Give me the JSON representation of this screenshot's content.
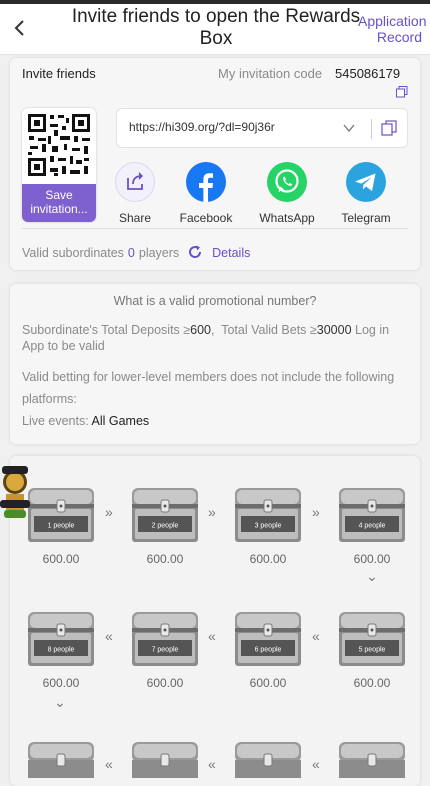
{
  "header": {
    "title": "Invite friends to open the Rewards Box",
    "right_link": "Application Record"
  },
  "invite": {
    "label": "Invite friends",
    "code_label": "My invitation code",
    "code": "545086179",
    "save_label": "Save invitation...",
    "link": "https://hi309.org/?dl=90j36r"
  },
  "share": [
    {
      "label": "Share",
      "icon": "share-arrow-icon",
      "color": "#f2f0fb"
    },
    {
      "label": "Facebook",
      "icon": "facebook-icon",
      "color": "#1877f2"
    },
    {
      "label": "WhatsApp",
      "icon": "whatsapp-icon",
      "color": "#25d366"
    },
    {
      "label": "Telegram",
      "icon": "telegram-icon",
      "color": "#2aa3df"
    }
  ],
  "valid": {
    "label": "Valid subordinates",
    "count": "0",
    "unit": "players",
    "details": "Details"
  },
  "rules": {
    "title": "What is a valid promotional number?",
    "deposits_label": "Subordinate's Total Deposits ≥",
    "deposits_value": "600",
    "bets_label": "Total Valid Bets ≥",
    "bets_value": "30000",
    "suffix": "Log in App to be valid",
    "exclusion": "Valid betting for lower-level members does not include the following platforms:",
    "live_label": "Live events:",
    "live_value": "All Games"
  },
  "chests": [
    {
      "people": "1 people",
      "amount": "600.00"
    },
    {
      "people": "2 people",
      "amount": "600.00"
    },
    {
      "people": "3 people",
      "amount": "600.00"
    },
    {
      "people": "4 people",
      "amount": "600.00"
    },
    {
      "people": "5 people",
      "amount": "600.00"
    },
    {
      "people": "6 people",
      "amount": "600.00"
    },
    {
      "people": "7 people",
      "amount": "600.00"
    },
    {
      "people": "8 people",
      "amount": "600.00"
    }
  ],
  "colors": {
    "accent": "#7f60cf",
    "link": "#6a50c8"
  }
}
